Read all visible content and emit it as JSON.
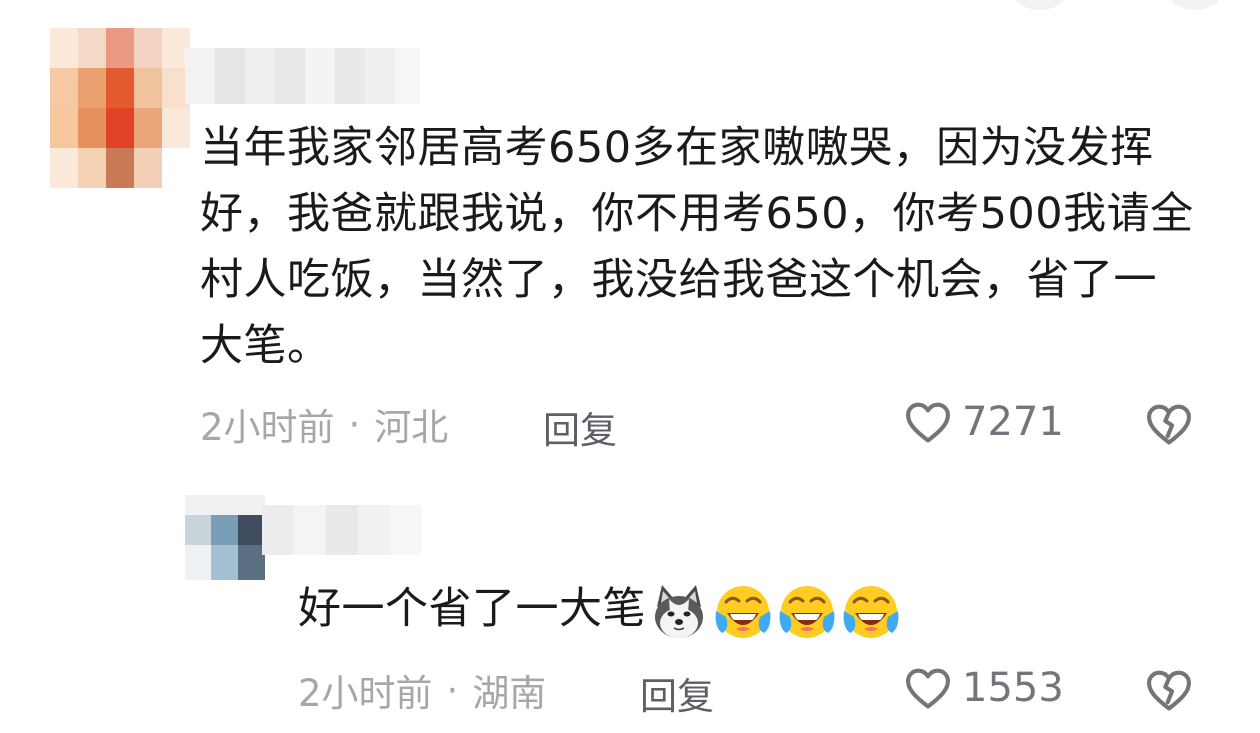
{
  "comments": [
    {
      "text": "当年我家邻居高考650多在家嗷嗷哭，因为没发挥好，我爸就跟我说，你不用考650，你考500我请全村人吃饭，当然了，我没给我爸这个机会，省了一大笔。",
      "time": "2小时前",
      "separator": "·",
      "location": "河北",
      "reply_label": "回复",
      "like_count": "7271"
    },
    {
      "text": "好一个省了一大笔",
      "emojis": [
        "husky-dog-emoji",
        "laughing-crying-emoji",
        "laughing-crying-emoji",
        "laughing-crying-emoji"
      ],
      "time": "2小时前",
      "separator": "·",
      "location": "湖南",
      "reply_label": "回复",
      "like_count": "1553"
    }
  ],
  "icons": {
    "like": "heart-outline-icon",
    "dislike": "broken-heart-icon"
  },
  "colors": {
    "text": "#1a1a1a",
    "meta": "#a7a7ab",
    "reply": "#5e5f66",
    "icon": "#74757b"
  }
}
